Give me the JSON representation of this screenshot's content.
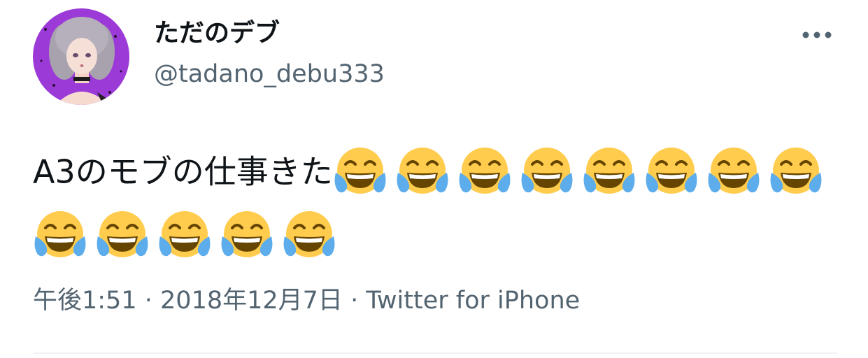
{
  "tweet": {
    "author": {
      "display_name": "ただのデブ",
      "handle": "@tadano_debu333",
      "avatar_icon": "profile-avatar-illustration"
    },
    "text": "A3のモブの仕事きた",
    "emoji": {
      "name": "face-with-tears-of-joy",
      "count": 13
    },
    "meta": {
      "time": "午後1:51",
      "separator": "·",
      "date": "2018年12月7日",
      "source": "Twitter for iPhone"
    },
    "more_icon": "more-horizontal-icon"
  },
  "colors": {
    "text": "#0f1419",
    "secondary": "#536471",
    "divider": "#eff3f4",
    "avatar_bg": "#9b3ad6"
  }
}
